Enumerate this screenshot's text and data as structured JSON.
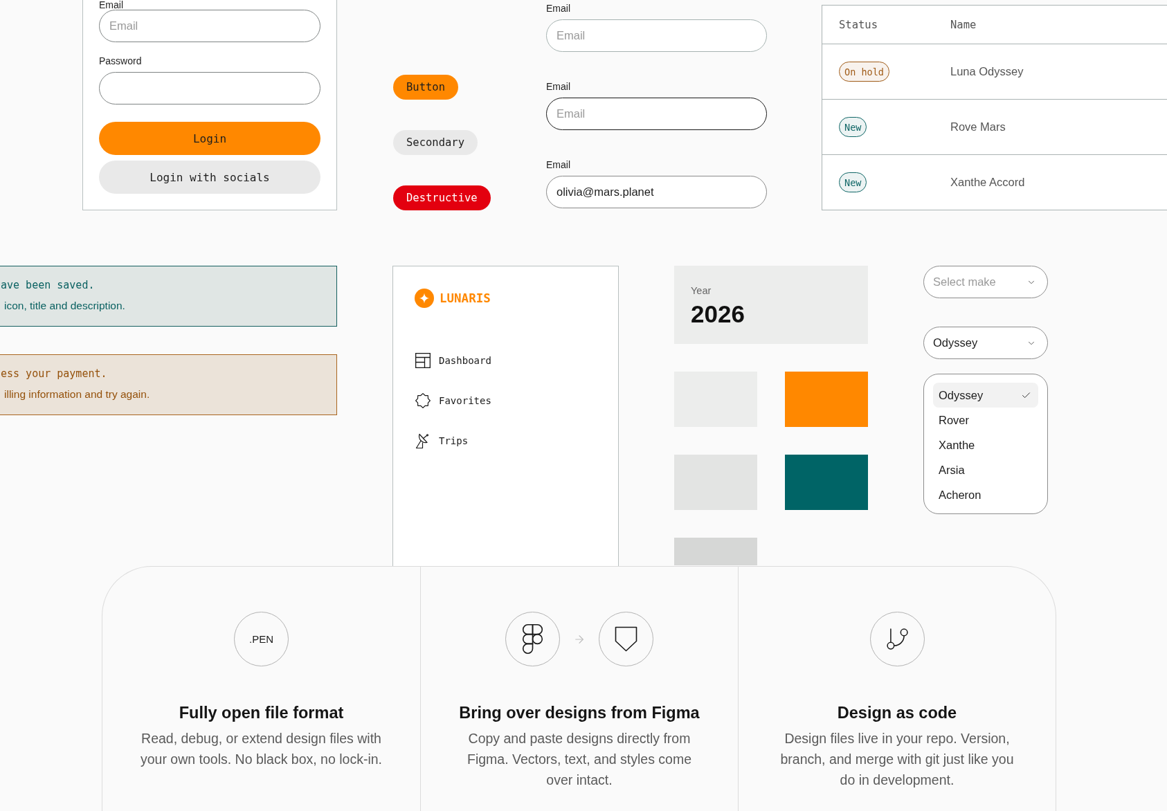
{
  "login_form": {
    "fields": [
      {
        "label": "Email",
        "placeholder": "Email"
      },
      {
        "label": "Password"
      }
    ],
    "buttons": [
      {
        "label": "Login",
        "kind": "primary"
      },
      {
        "label": "Login with socials",
        "kind": "secondary"
      }
    ]
  },
  "buttons": [
    {
      "label": "Button",
      "kind": "primary"
    },
    {
      "label": "Secondary",
      "kind": "secondary"
    },
    {
      "label": "Destructive",
      "kind": "destructive"
    }
  ],
  "email_fields": [
    {
      "label": "Email",
      "placeholder": "Email",
      "focused": false
    },
    {
      "label": "Email",
      "placeholder": "Email",
      "focused": true
    },
    {
      "label": "Email",
      "value": "olivia@mars.planet",
      "focused": false
    }
  ],
  "table": {
    "columns": [
      "Status",
      "Name"
    ],
    "rows": [
      {
        "status": {
          "label": "On hold",
          "color": "#a05c18"
        },
        "name": "Luna Odyssey"
      },
      {
        "status": {
          "label": "New",
          "color": "#0f6666"
        },
        "name": "Rove Mars"
      },
      {
        "status": {
          "label": "New",
          "color": "#0f6666"
        },
        "name": "Xanthe Accord"
      }
    ]
  },
  "alerts": [
    {
      "kind": "success",
      "title": "ave been saved.",
      "description": "icon, title and description."
    },
    {
      "kind": "error",
      "title": "ess your payment.",
      "description": "illing information and try again."
    }
  ],
  "sidebar": {
    "brand": "LUNARIS",
    "items": [
      {
        "label": "Dashboard",
        "selected": false
      },
      {
        "label": "Favorites",
        "selected": false
      },
      {
        "label": "Trips",
        "selected": false
      }
    ]
  },
  "year_card": {
    "label": "Year",
    "value": "2026"
  },
  "swatches": [
    {
      "color": "#ecedec"
    },
    {
      "color": "#ff8800"
    },
    {
      "color": "#e3e4e3"
    },
    {
      "color": "#006466"
    },
    {
      "color": "#d6d7d6"
    }
  ],
  "selects": [
    {
      "placeholder": "Select make"
    },
    {
      "value": "Odyssey"
    }
  ],
  "dropdown": {
    "options": [
      {
        "label": "Odyssey",
        "selected": true
      },
      {
        "label": "Rover",
        "selected": false
      },
      {
        "label": "Xanthe",
        "selected": false
      },
      {
        "label": "Arsia",
        "selected": false
      },
      {
        "label": "Acheron",
        "selected": false
      }
    ]
  },
  "features": [
    {
      "kind": "file_format",
      "emblem": ".PEN",
      "title": "Fully open file format",
      "description": "Read, debug, or extend design files with your own tools. No black box, no lock-in."
    },
    {
      "kind": "import",
      "title": "Bring over designs from Figma",
      "description": "Copy and paste designs directly from Figma. Vectors, text, and styles come over intact."
    },
    {
      "kind": "code",
      "title": "Design as code",
      "description": "Design files live in your repo. Version, branch, and merge with git just like you do in development."
    }
  ]
}
